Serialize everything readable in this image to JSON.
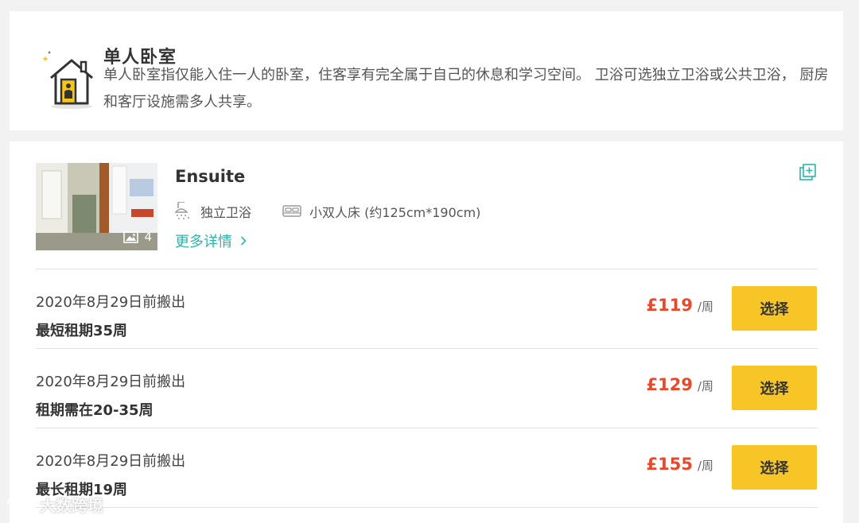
{
  "intro": {
    "title": "单人卧室",
    "description": "单人卧室指仅能入住一人的卧室，住客享有完全属于自己的休息和学习空间。 卫浴可选独立卫浴或公共卫浴， 厨房和客厅设施需多人共享。",
    "icon": "house-with-person-icon"
  },
  "room": {
    "name": "Ensuite",
    "photo_count": "4",
    "features": [
      {
        "icon": "shower-icon",
        "label": "独立卫浴"
      },
      {
        "icon": "bed-icon",
        "label": "小双人床 (约125cm*190cm)"
      }
    ],
    "more_label": "更多详情"
  },
  "options": [
    {
      "move_out": "2020年8月29日前搬出",
      "term": "最短租期35周",
      "price": "£119",
      "unit": "/周",
      "button": "选择"
    },
    {
      "move_out": "2020年8月29日前搬出",
      "term": "租期需在20-35周",
      "price": "£129",
      "unit": "/周",
      "button": "选择"
    },
    {
      "move_out": "2020年8月29日前搬出",
      "term": "最长租期19周",
      "price": "£155",
      "unit": "/周",
      "button": "选择"
    }
  ],
  "watermark": "大数跨境",
  "colors": {
    "accent_teal": "#2bb5a8",
    "price_red": "#e8492c",
    "button_yellow": "#f7c525"
  }
}
